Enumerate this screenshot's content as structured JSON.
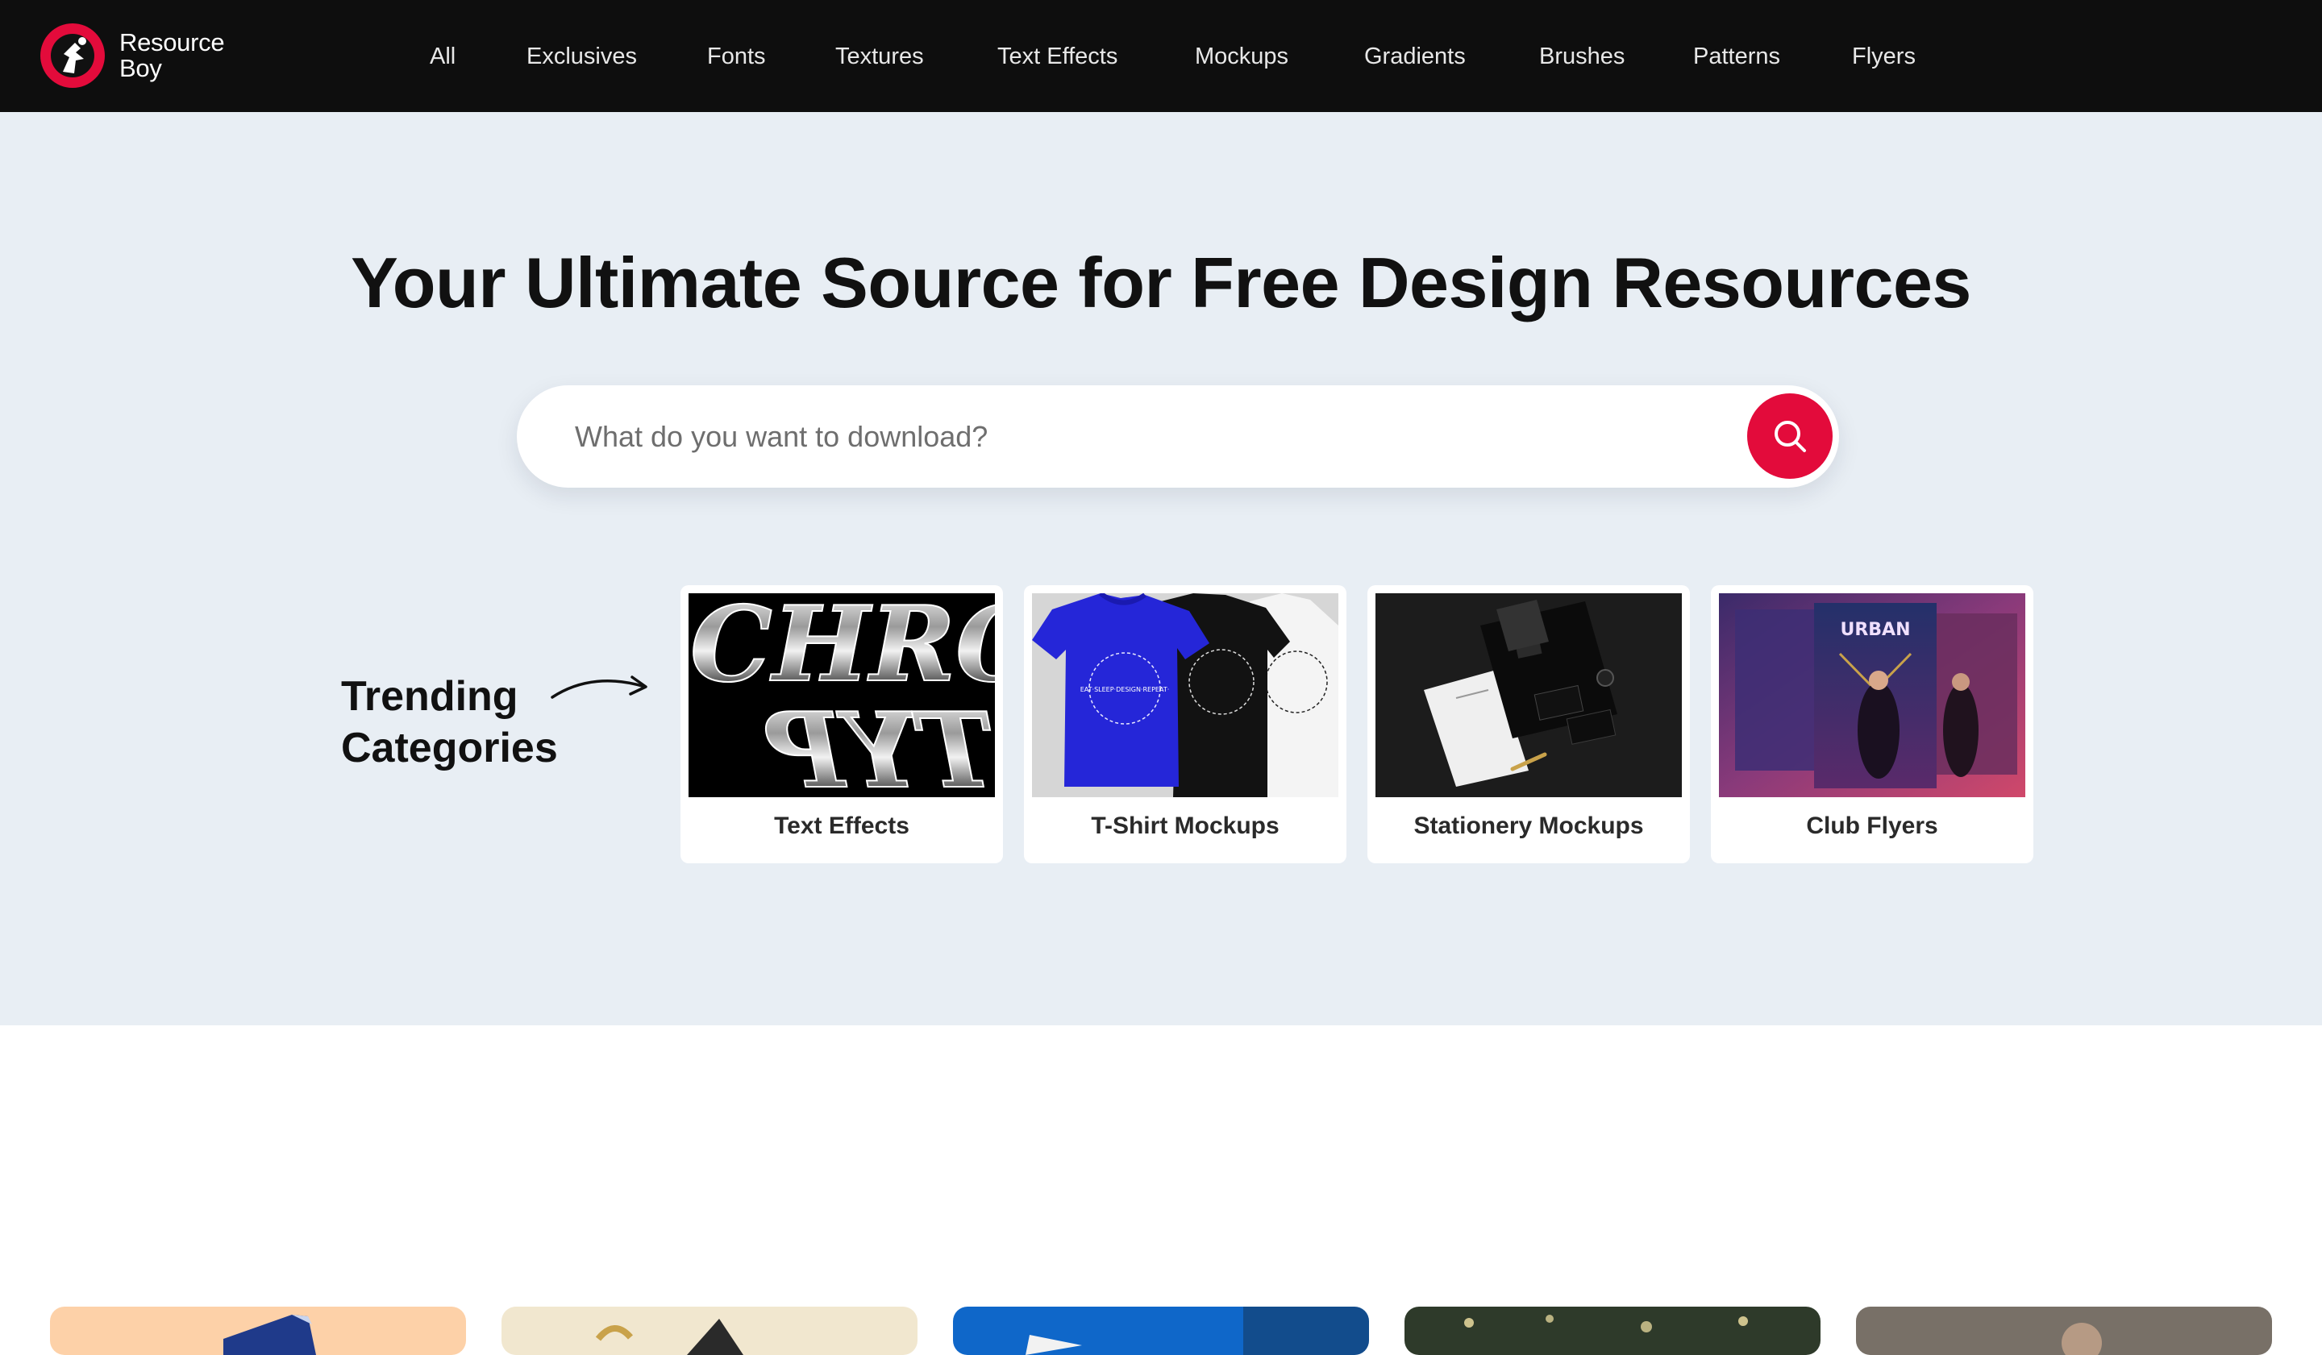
{
  "header": {
    "logo_line1": "Resource",
    "logo_line2": "Boy",
    "nav": [
      {
        "label": "All"
      },
      {
        "label": "Exclusives"
      },
      {
        "label": "Fonts"
      },
      {
        "label": "Textures"
      },
      {
        "label": "Text Effects"
      },
      {
        "label": "Mockups"
      },
      {
        "label": "Gradients"
      },
      {
        "label": "Brushes"
      },
      {
        "label": "Patterns"
      },
      {
        "label": "Flyers"
      }
    ]
  },
  "hero": {
    "title": "Your Ultimate Source for Free Design Resources",
    "search_placeholder": "What do you want to download?"
  },
  "trending": {
    "line1": "Trending",
    "line2": "Categories",
    "cards": [
      {
        "caption": "Text Effects",
        "thumb_text_top": "CHRO",
        "thumb_text_bottom": "TYP"
      },
      {
        "caption": "T-Shirt Mockups",
        "shirt_text": "EAT·SLEEP·DESIGN·REPEAT·"
      },
      {
        "caption": "Stationery Mockups"
      },
      {
        "caption": "Club Flyers",
        "flyer_text": "URBAN"
      }
    ]
  },
  "colors": {
    "header_bg": "#0e0e0e",
    "hero_bg": "#e8eef4",
    "accent": "#e30b3b"
  }
}
